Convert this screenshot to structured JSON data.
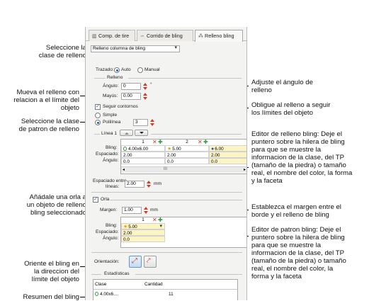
{
  "tabs": [
    {
      "label": "Comp. de tire",
      "icon": "tire-icon"
    },
    {
      "label": "Corrido de bling",
      "icon": "run-icon"
    },
    {
      "label": "Relleno bling",
      "icon": "fill-icon"
    }
  ],
  "fill_class": {
    "value": "Relleno columna de bling"
  },
  "trazado": {
    "label": "Trazado:",
    "auto": "Auto",
    "manual": "Manual"
  },
  "relleno": {
    "group": "Relleno",
    "angle_label": "Ángulo:",
    "angle_value": "0",
    "angle_unit": "°",
    "offset_label": "Mayús:",
    "offset_value": "0.00",
    "follow_label": "Seguir contornos"
  },
  "pattern": {
    "simple": "Simple",
    "polilinea": "Polilínea",
    "polilinea_count": "3"
  },
  "linea": {
    "label": "Línea 1",
    "cols": [
      "1",
      "2"
    ],
    "rows": [
      {
        "label": "Bling:",
        "cells": [
          "4.00x6.00",
          "5.00",
          "6.00"
        ]
      },
      {
        "label": "Espaciado:",
        "cells": [
          "2.00",
          "2.00",
          "2.00"
        ]
      },
      {
        "label": "Ángulo:",
        "cells": [
          "0.0",
          "0.0",
          "0.0"
        ]
      }
    ],
    "scroll_mark": "III",
    "line_spacing_label_1": "Espaciado entre",
    "line_spacing_label_2": "líneas:",
    "line_spacing_value": "2.00",
    "line_spacing_unit": "mm"
  },
  "orla": {
    "label": "Orla",
    "margin_label": "Margen:",
    "margin_value": "1.00",
    "margin_unit": "mm",
    "col": "1",
    "rows": [
      {
        "label": "Bling:",
        "cell": "5.00"
      },
      {
        "label": "Espaciado:",
        "cell": "2.00"
      },
      {
        "label": "Ángulo:",
        "cell": "0.0"
      }
    ]
  },
  "orientation": {
    "label": "Orientación:"
  },
  "stats": {
    "title": "Estadísticas",
    "col_class": "Clase",
    "col_count": "Cantidad",
    "row_class": "4.00x6....",
    "row_count": "11"
  },
  "annotations": {
    "left": [
      "Seleccione la\nclase de relleno",
      "Mueva el relleno con\nrelacion a el límite del\nobjeto",
      "Seleccione la clase\nde patron de relleno",
      "Añádale una orla a\nun objeto de relleno\nbling seleccionado",
      "Oriente el bling en\nla direccion del\nlímite del objeto",
      "Resumen del bling"
    ],
    "right": [
      "Adjuste el ángulo de\nrelleno",
      "Obligue al relleno a seguir\nlos límites del objeto",
      "Editor de relleno bling: Deje el\npuntero sobre la hilera de bling\npara que se muestre la\ninformacion de la clase, del TP\n(tamaño de la piedra) o tamaño\nreal, el nombre del color, la forma\ny la faceta",
      "Establezca el margen entre el\nborde y el relleno de bling",
      "Editor de patron bling: Deje el\npuntero sobre la hilera de bling\npara que se muestre la\ninformacion de la clase, del TP\n(tamaño de la piedra) o tamaño\nreal, el nombre del color, la\nforma y la faceta"
    ]
  }
}
